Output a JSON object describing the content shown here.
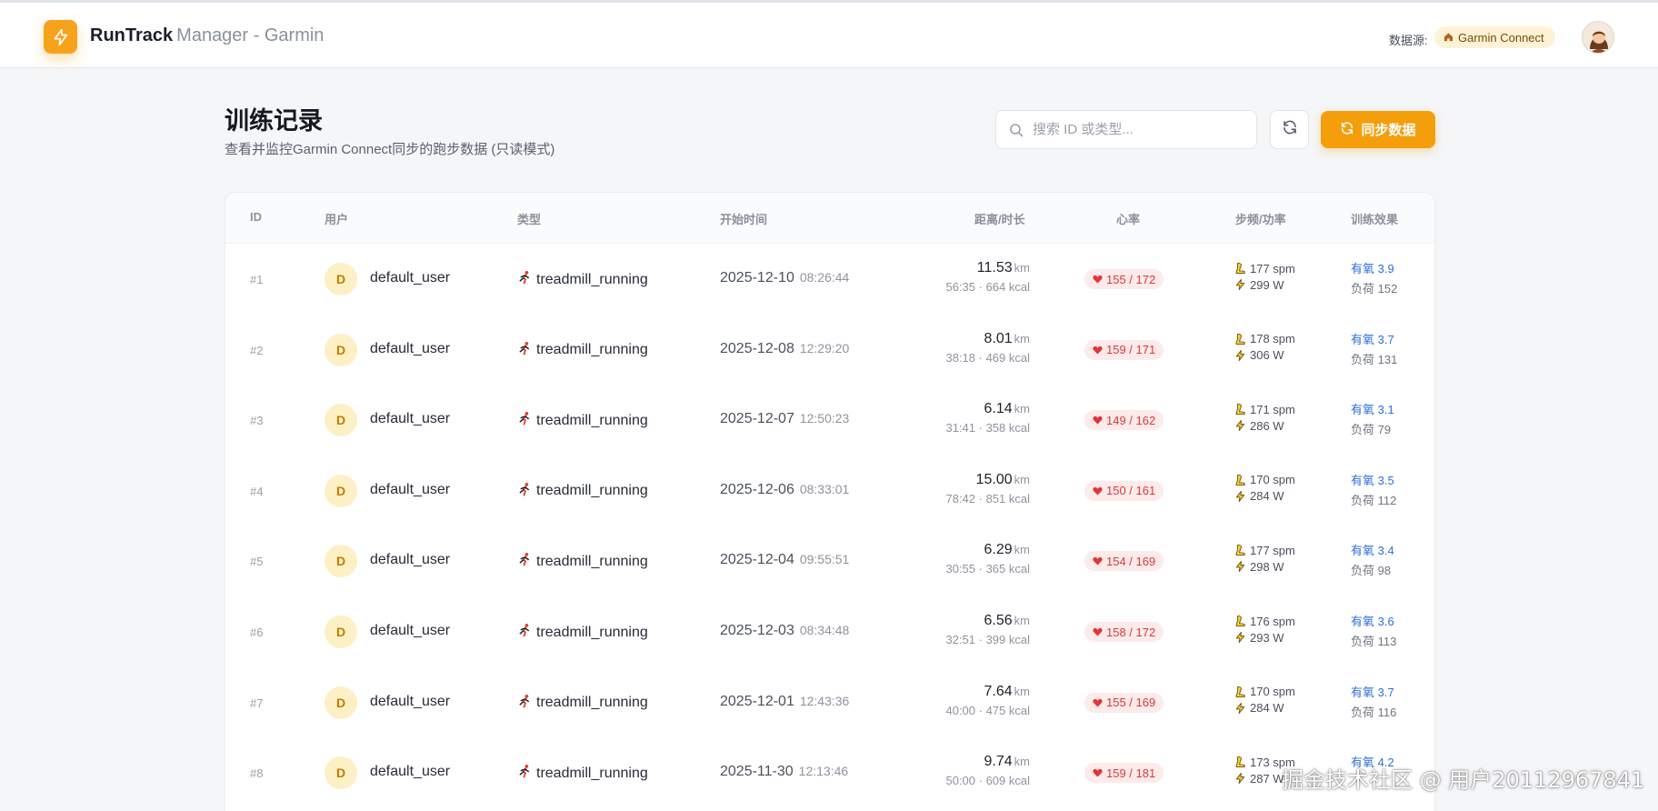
{
  "header": {
    "brand_bold": "RunTrack",
    "brand_light": "Manager - Garmin",
    "source_label": "数据源:",
    "source_badge": "Garmin Connect"
  },
  "page": {
    "title": "训练记录",
    "subtitle": "查看并监控Garmin Connect同步的跑步数据 (只读模式)"
  },
  "search": {
    "placeholder": "搜索 ID 或类型..."
  },
  "sync_label": "同步数据",
  "table": {
    "headers": {
      "id": "ID",
      "user": "用户",
      "type": "类型",
      "start": "开始时间",
      "dist": "距离/时长",
      "hr": "心率",
      "cadence": "步频/功率",
      "effect": "训练效果"
    },
    "rows": [
      {
        "id": "#1",
        "avatar": "D",
        "user": "default_user",
        "type": "treadmill_running",
        "date": "2025-12-10",
        "time": "08:26:44",
        "km": "11.53",
        "km_unit": "km",
        "dur": "56:35 · 664 kcal",
        "hr": "155 / 172",
        "spm": "177 spm",
        "watt": "299 W",
        "aer": "有氧 3.9",
        "load": "负荷 152"
      },
      {
        "id": "#2",
        "avatar": "D",
        "user": "default_user",
        "type": "treadmill_running",
        "date": "2025-12-08",
        "time": "12:29:20",
        "km": "8.01",
        "km_unit": "km",
        "dur": "38:18 · 469 kcal",
        "hr": "159 / 171",
        "spm": "178 spm",
        "watt": "306 W",
        "aer": "有氧 3.7",
        "load": "负荷 131"
      },
      {
        "id": "#3",
        "avatar": "D",
        "user": "default_user",
        "type": "treadmill_running",
        "date": "2025-12-07",
        "time": "12:50:23",
        "km": "6.14",
        "km_unit": "km",
        "dur": "31:41 · 358 kcal",
        "hr": "149 / 162",
        "spm": "171 spm",
        "watt": "286 W",
        "aer": "有氧 3.1",
        "load": "负荷 79"
      },
      {
        "id": "#4",
        "avatar": "D",
        "user": "default_user",
        "type": "treadmill_running",
        "date": "2025-12-06",
        "time": "08:33:01",
        "km": "15.00",
        "km_unit": "km",
        "dur": "78:42 · 851 kcal",
        "hr": "150 / 161",
        "spm": "170 spm",
        "watt": "284 W",
        "aer": "有氧 3.5",
        "load": "负荷 112"
      },
      {
        "id": "#5",
        "avatar": "D",
        "user": "default_user",
        "type": "treadmill_running",
        "date": "2025-12-04",
        "time": "09:55:51",
        "km": "6.29",
        "km_unit": "km",
        "dur": "30:55 · 365 kcal",
        "hr": "154 / 169",
        "spm": "177 spm",
        "watt": "298 W",
        "aer": "有氧 3.4",
        "load": "负荷 98"
      },
      {
        "id": "#6",
        "avatar": "D",
        "user": "default_user",
        "type": "treadmill_running",
        "date": "2025-12-03",
        "time": "08:34:48",
        "km": "6.56",
        "km_unit": "km",
        "dur": "32:51 · 399 kcal",
        "hr": "158 / 172",
        "spm": "176 spm",
        "watt": "293 W",
        "aer": "有氧 3.6",
        "load": "负荷 113"
      },
      {
        "id": "#7",
        "avatar": "D",
        "user": "default_user",
        "type": "treadmill_running",
        "date": "2025-12-01",
        "time": "12:43:36",
        "km": "7.64",
        "km_unit": "km",
        "dur": "40:00 · 475 kcal",
        "hr": "155 / 169",
        "spm": "170 spm",
        "watt": "284 W",
        "aer": "有氧 3.7",
        "load": "负荷 116"
      },
      {
        "id": "#8",
        "avatar": "D",
        "user": "default_user",
        "type": "treadmill_running",
        "date": "2025-11-30",
        "time": "12:13:46",
        "km": "9.74",
        "km_unit": "km",
        "dur": "50:00 · 609 kcal",
        "hr": "159 / 181",
        "spm": "173 spm",
        "watt": "287 W",
        "aer": "有氧 4.2",
        "load": ""
      }
    ]
  },
  "watermark": "掘金技术社区 @ 用户20112967841",
  "colors": {
    "accent": "#f59e0b",
    "heart": "#d83a3a",
    "link": "#2f6fd6"
  },
  "icons": [
    "bolt-icon",
    "house-icon",
    "user-avatar-icon",
    "search-icon",
    "refresh-icon",
    "sync-icon",
    "runner-icon",
    "heart-icon",
    "shoe-icon",
    "power-icon"
  ]
}
